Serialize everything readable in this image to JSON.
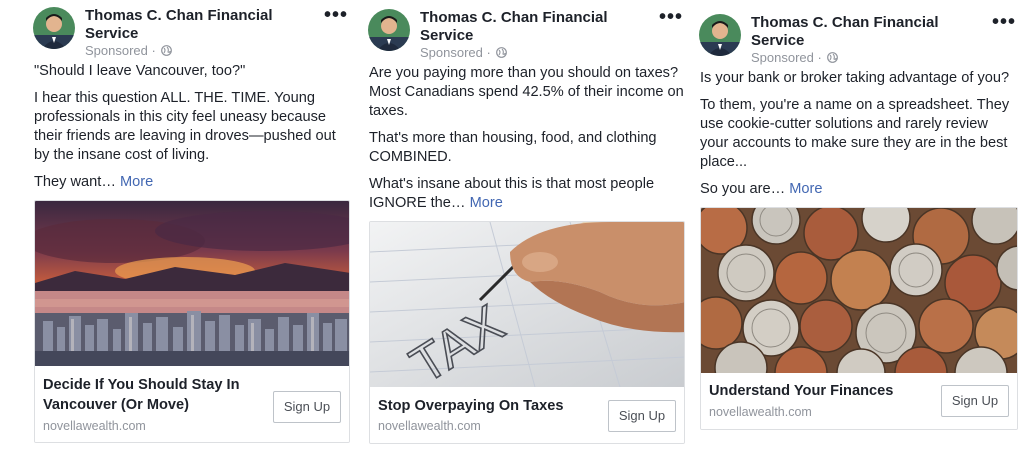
{
  "ads": [
    {
      "advertiser": "Thomas C. Chan Financial Service",
      "sponsored": "Sponsored",
      "separator": "·",
      "paragraphs": [
        "\"Should I leave Vancouver, too?\"",
        "I hear this question ALL. THE. TIME. Young professionals in this city feel uneasy because their friends are leaving in droves—pushed out by the insane cost of living."
      ],
      "teaser": "They want…",
      "more": "More",
      "image": "vancouver-sunset-skyline",
      "headline": "Decide If You Should Stay In Vancouver (Or Move)",
      "domain": "novellawealth.com",
      "cta": "Sign Up"
    },
    {
      "advertiser": "Thomas C. Chan Financial Service",
      "sponsored": "Sponsored",
      "separator": "·",
      "paragraphs": [
        "Are you paying more than you should on taxes? Most Canadians spend 42.5% of their income on taxes.",
        "That's more than housing, food, and clothing COMBINED."
      ],
      "teaser": "What's insane about this is that most people IGNORE the…",
      "more": "More",
      "image": "hand-writing-tax",
      "headline": "Stop Overpaying On Taxes",
      "domain": "novellawealth.com",
      "cta": "Sign Up"
    },
    {
      "advertiser": "Thomas C. Chan Financial Service",
      "sponsored": "Sponsored",
      "separator": "·",
      "paragraphs": [
        "Is your bank or broker taking advantage of you?",
        "To them, you're a name on a spreadsheet. They use cookie-cutter solutions and rarely review your accounts to make sure they are in the best place..."
      ],
      "teaser": "So you are…",
      "more": "More",
      "image": "pile-of-coins",
      "headline": "Understand Your Finances",
      "domain": "novellawealth.com",
      "cta": "Sign Up"
    }
  ],
  "image_text": "TAX",
  "icons": {
    "menu": "more-options-icon",
    "audience": "globe-icon"
  },
  "colors": {
    "link": "#4267b2",
    "meta": "#90949c",
    "text": "#1d2129",
    "border": "#dddfe2"
  }
}
